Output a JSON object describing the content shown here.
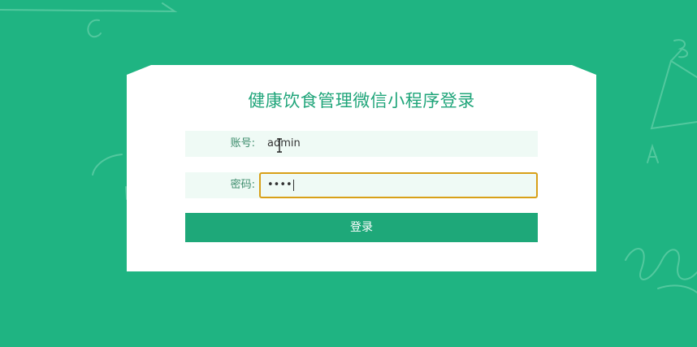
{
  "login": {
    "title": "健康饮食管理微信小程序登录",
    "account_label": "账号:",
    "account_value": "admin",
    "password_label": "密码:",
    "password_value": "••••",
    "submit_label": "登录"
  },
  "colors": {
    "background": "#1fb482",
    "card": "#ffffff",
    "accent": "#20a57a",
    "button": "#1ea879",
    "field_bg": "#effaf5",
    "focus_border": "#d8a018"
  }
}
